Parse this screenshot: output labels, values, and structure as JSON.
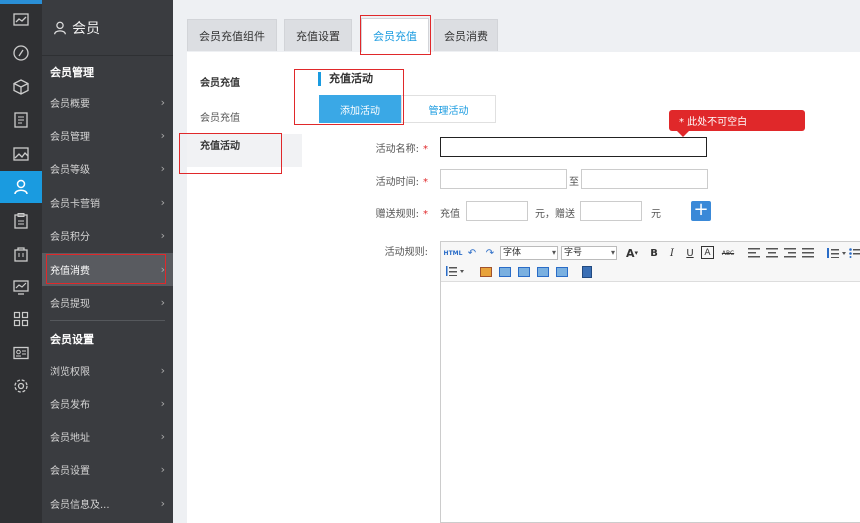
{
  "rail": {
    "icons": [
      "chart-icon",
      "disc-icon",
      "cube-icon",
      "document-icon",
      "image-icon",
      "member-icon",
      "clipboard-icon",
      "bag-icon",
      "monitor-chart-icon",
      "grid-icon",
      "id-card-icon",
      "settings-icon"
    ],
    "active_index": 5,
    "accent": "#1a9be0"
  },
  "menu": {
    "title": "会员",
    "section1": "会员管理",
    "items1": [
      "会员概要",
      "会员管理",
      "会员等级",
      "会员卡营销",
      "会员积分",
      "充值消费",
      "会员提现"
    ],
    "section2": "会员设置",
    "items2": [
      "浏览权限",
      "会员发布",
      "会员地址",
      "会员设置",
      "会员信息及..."
    ],
    "chevron": "›"
  },
  "tabs": [
    {
      "label": "会员充值组件"
    },
    {
      "label": "充值设置"
    },
    {
      "label": "会员充值"
    },
    {
      "label": "会员消费"
    }
  ],
  "subnav": {
    "head": "会员充值",
    "link": "会员充值",
    "active": "充值活动"
  },
  "content": {
    "section_title": "充值活动",
    "add_button": "添加活动",
    "manage_button": "管理活动",
    "tooltip": "* 此处不可空白",
    "name_label": "活动名称:",
    "time_label": "活动时间:",
    "time_to": "至",
    "gift_label": "赠送规则:",
    "gift_recharge": "充值",
    "gift_mid": "元，赠送",
    "gift_unit": "元",
    "rule_label": "活动规则:",
    "required": "*",
    "plus": "+"
  },
  "editor": {
    "html": "HTML",
    "font_placeholder": "字体",
    "size_placeholder": "字号",
    "font_color": "A",
    "bold": "B",
    "italic": "I",
    "underline": "U",
    "bg_color": "A",
    "strike": "ABC"
  }
}
